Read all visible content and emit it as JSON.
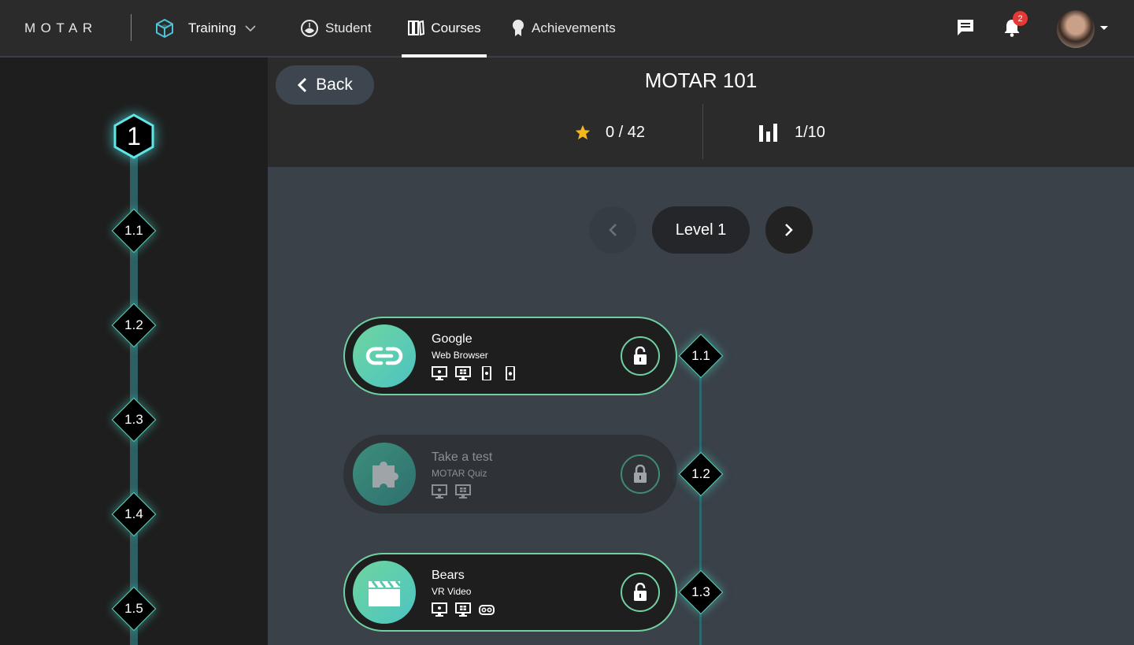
{
  "app": {
    "logo": "MOTAR"
  },
  "nav": {
    "mode_label": "Training",
    "links": [
      {
        "label": "Student",
        "icon": "student-icon"
      },
      {
        "label": "Courses",
        "icon": "courses-icon",
        "active": true
      },
      {
        "label": "Achievements",
        "icon": "achievements-icon"
      }
    ],
    "notification_count": "2"
  },
  "header": {
    "back_label": "Back",
    "course_title": "MOTAR 101",
    "stars": "0 / 42",
    "level_progress": "1/10"
  },
  "pager": {
    "label": "Level 1"
  },
  "sidebar": {
    "level_marker": "1",
    "nodes": [
      "1.1",
      "1.2",
      "1.3",
      "1.4",
      "1.5"
    ]
  },
  "activities": [
    {
      "title": "Google",
      "subtitle": "Web Browser",
      "icon": "link-icon",
      "locked": false,
      "node": "1.1",
      "platforms": [
        "mac-icon",
        "windows-icon",
        "android-icon",
        "ios-icon"
      ]
    },
    {
      "title": "Take a test",
      "subtitle": "MOTAR Quiz",
      "icon": "puzzle-icon",
      "locked": true,
      "node": "1.2",
      "platforms": [
        "mac-icon",
        "windows-icon"
      ]
    },
    {
      "title": "Bears",
      "subtitle": "VR Video",
      "icon": "clapperboard-icon",
      "locked": false,
      "node": "1.3",
      "platforms": [
        "mac-icon",
        "windows-icon",
        "vr-headset-icon"
      ]
    }
  ],
  "colors": {
    "accent": "#6fd1a1",
    "teal_glow": "#5fdcc4",
    "star": "#f5b81c",
    "badge": "#e53935"
  }
}
